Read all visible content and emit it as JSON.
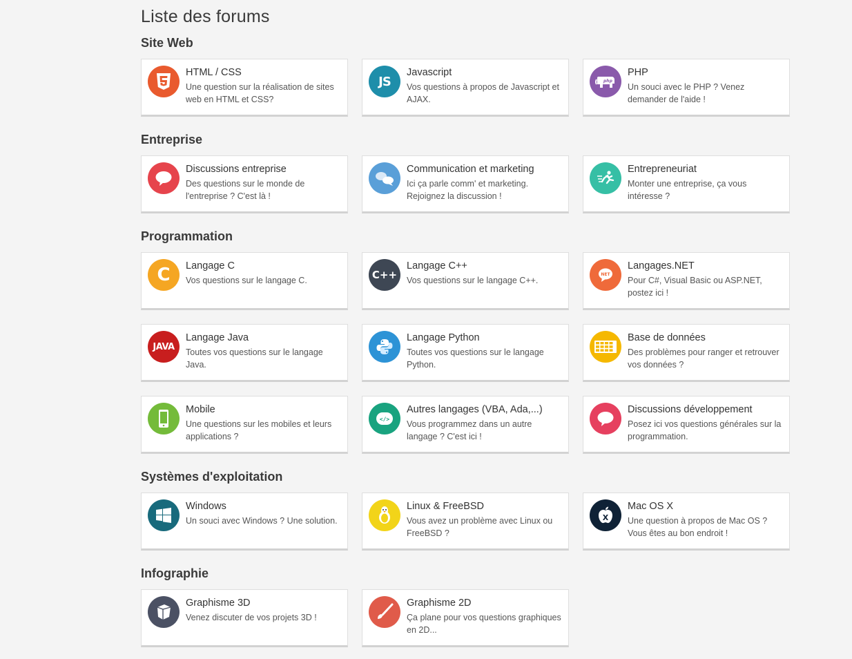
{
  "page": {
    "title": "Liste des forums"
  },
  "sections": [
    {
      "title": "Site Web",
      "forums": [
        {
          "name": "HTML / CSS",
          "desc": "Une question sur la réalisation de sites web en HTML et CSS?",
          "icon": "html5-icon",
          "color": "#e95a2e"
        },
        {
          "name": "Javascript",
          "desc": "Vos questions à propos de Javascript et AJAX.",
          "icon": "js-icon",
          "color": "#1e8eaa"
        },
        {
          "name": "PHP",
          "desc": "Un souci avec le PHP ? Venez demander de l'aide !",
          "icon": "php-elephant-icon",
          "color": "#8a5aab"
        }
      ]
    },
    {
      "title": "Entreprise",
      "forums": [
        {
          "name": "Discussions entreprise",
          "desc": "Des questions sur le monde de l'entreprise ? C'est là !",
          "icon": "speech-bubble-icon",
          "color": "#e6444c"
        },
        {
          "name": "Communication et marketing",
          "desc": "Ici ça parle comm' et marketing. Rejoignez la discussion !",
          "icon": "chat-bubbles-icon",
          "color": "#5a9fd8"
        },
        {
          "name": "Entrepreneuriat",
          "desc": "Monter une entreprise, ça vous intéresse ?",
          "icon": "running-man-icon",
          "color": "#36bfa5"
        }
      ]
    },
    {
      "title": "Programmation",
      "forums": [
        {
          "name": "Langage C",
          "desc": "Vos questions sur le langage C.",
          "icon": "c-icon",
          "color": "#f5a623"
        },
        {
          "name": "Langage C++",
          "desc": "Vos questions sur le langage C++.",
          "icon": "cpp-icon",
          "color": "#3e4754"
        },
        {
          "name": "Langages.NET",
          "desc": "Pour C#, Visual Basic ou ASP.NET, postez ici !",
          "icon": "dotnet-icon",
          "color": "#ef6a3a"
        },
        {
          "name": "Langage Java",
          "desc": "Toutes vos questions sur le langage Java.",
          "icon": "java-icon",
          "color": "#c81e1e"
        },
        {
          "name": "Langage Python",
          "desc": "Toutes vos questions sur le langage Python.",
          "icon": "python-icon",
          "color": "#2d93d6"
        },
        {
          "name": "Base de données",
          "desc": "Des problèmes pour ranger et retrouver vos données ?",
          "icon": "database-grid-icon",
          "color": "#f5b800"
        },
        {
          "name": "Mobile",
          "desc": "Une questions sur les mobiles et leurs applications ?",
          "icon": "mobile-phone-icon",
          "color": "#74bb3a"
        },
        {
          "name": "Autres langages (VBA, Ada,...)",
          "desc": "Vous programmez dans un autre langage ? C'est ici !",
          "icon": "code-tag-icon",
          "color": "#19a37f"
        },
        {
          "name": "Discussions développement",
          "desc": "Posez ici vos questions générales sur la programmation.",
          "icon": "speech-bubble-icon",
          "color": "#e6405f"
        }
      ]
    },
    {
      "title": "Systèmes d'exploitation",
      "forums": [
        {
          "name": "Windows",
          "desc": "Un souci avec Windows ? Une solution.",
          "icon": "windows-icon",
          "color": "#186a7c"
        },
        {
          "name": "Linux & FreeBSD",
          "desc": "Vous avez un problème avec Linux ou FreeBSD ?",
          "icon": "tux-icon",
          "color": "#f2d419"
        },
        {
          "name": "Mac OS X",
          "desc": "Une question à propos de Mac OS ? Vous êtes au bon endroit !",
          "icon": "macosx-icon",
          "color": "#0f2236"
        }
      ]
    },
    {
      "title": "Infographie",
      "forums": [
        {
          "name": "Graphisme 3D",
          "desc": "Venez discuter de vos projets 3D !",
          "icon": "cube-3d-icon",
          "color": "#4b5164"
        },
        {
          "name": "Graphisme 2D",
          "desc": "Ça plane pour vos questions graphiques en 2D...",
          "icon": "brush-icon",
          "color": "#e05b4a"
        }
      ]
    }
  ]
}
